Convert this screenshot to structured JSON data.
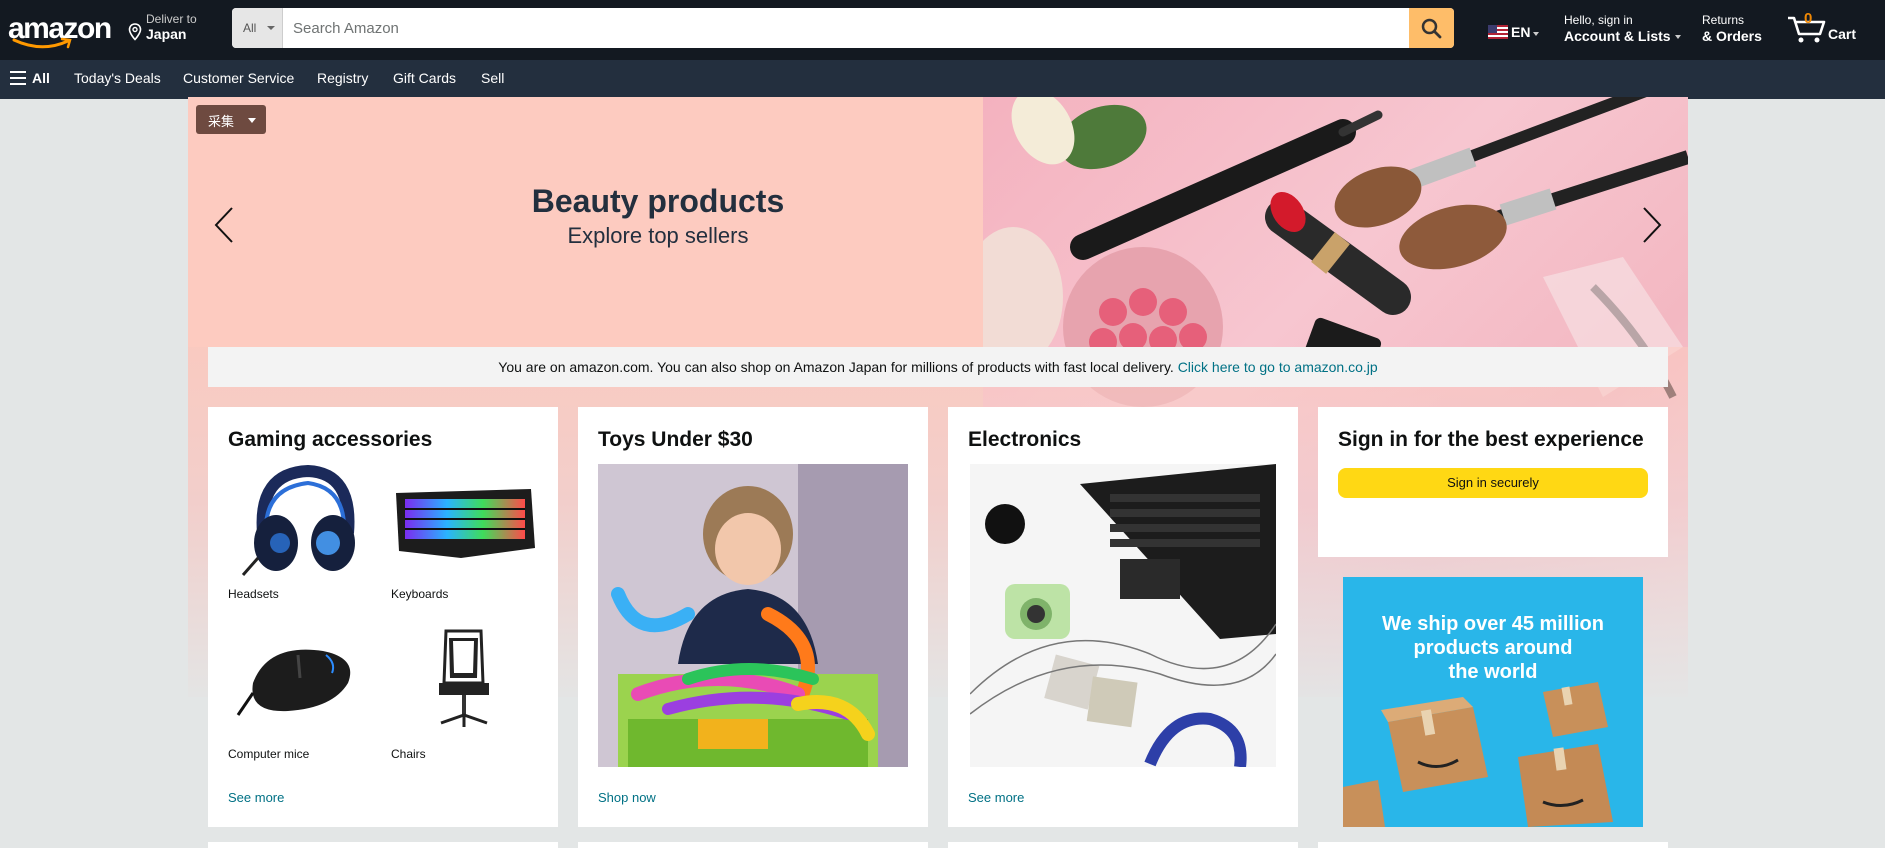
{
  "header": {
    "logo_text": "amazon",
    "deliver_line1": "Deliver to",
    "deliver_line2": "Japan",
    "search_category": "All",
    "search_placeholder": "Search Amazon",
    "language": "EN",
    "account_line1": "Hello, sign in",
    "account_line2": "Account & Lists",
    "returns_line1": "Returns",
    "returns_line2": "& Orders",
    "cart_count": "0",
    "cart_label": "Cart"
  },
  "subnav": {
    "all": "All",
    "items": [
      "Today's Deals",
      "Customer Service",
      "Registry",
      "Gift Cards",
      "Sell"
    ]
  },
  "hero": {
    "collect_button": "采集",
    "title": "Beauty products",
    "subtitle": "Explore top sellers"
  },
  "notice": {
    "text": "You are on amazon.com. You can also shop on Amazon Japan for millions of products with fast local delivery.",
    "link": "Click here to go to amazon.co.jp"
  },
  "cards": [
    {
      "title": "Gaming accessories",
      "items": [
        "Headsets",
        "Keyboards",
        "Computer mice",
        "Chairs"
      ],
      "link": "See more"
    },
    {
      "title": "Toys Under $30",
      "link": "Shop now"
    },
    {
      "title": "Electronics",
      "link": "See more"
    },
    {
      "title": "Sign in for the best experience",
      "button": "Sign in securely"
    }
  ],
  "ship_banner": {
    "text_line1": "We ship over 45 million",
    "text_line2": "products around",
    "text_line3": "the world"
  },
  "colors": {
    "nav_bg": "#131921",
    "subnav_bg": "#232f3e",
    "search_button": "#febd69",
    "signin_button": "#ffd814",
    "link": "#007185",
    "cart_count": "#f08804"
  }
}
